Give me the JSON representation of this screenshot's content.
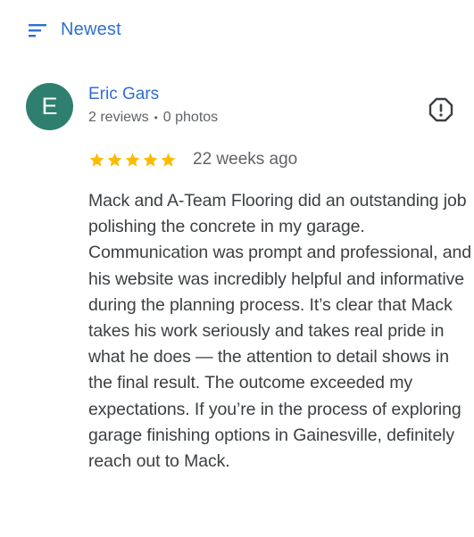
{
  "sort": {
    "icon": "sort-icon",
    "label": "Newest"
  },
  "review": {
    "avatar_initial": "E",
    "avatar_color": "#2f7f70",
    "reviewer_name": "Eric Gars",
    "reviews_count": "2 reviews",
    "separator": "•",
    "photos_count": "0 photos",
    "report_icon": "report-icon",
    "rating": 5,
    "rating_max": 5,
    "star_color": "#fbbc04",
    "time_ago": "22 weeks ago",
    "text": "Mack and A-Team Flooring did an outstanding job polishing the concrete in my garage. Communication was prompt and professional, and his website was incredibly helpful and informative during the planning process. It’s clear that Mack takes his work seriously and takes real pride in what he does — the attention to detail shows in the final result. The outcome exceeded my expectations. If you’re in the process of exploring garage finishing options in Gainesville, definitely reach out to Mack."
  },
  "colors": {
    "link": "#2f6fcf",
    "secondary_text": "#5f6368",
    "body_text": "#3c4043"
  }
}
